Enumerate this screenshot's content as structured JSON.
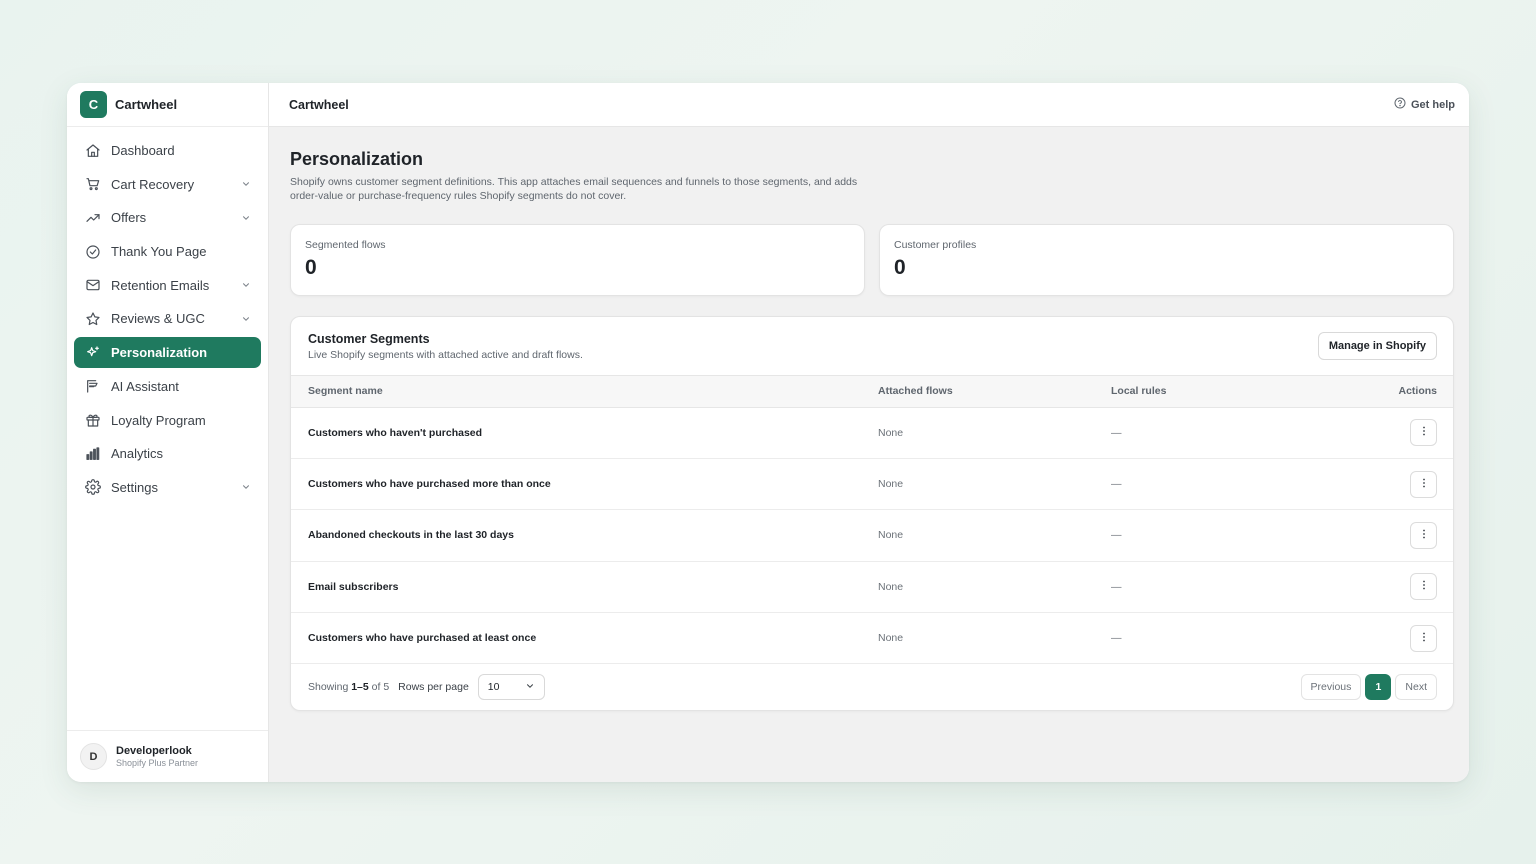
{
  "app": {
    "logo_letter": "C",
    "name": "Cartwheel"
  },
  "sidebar": {
    "items": [
      {
        "label": "Dashboard",
        "icon": "home-icon",
        "expandable": false,
        "active": false
      },
      {
        "label": "Cart Recovery",
        "icon": "cart-icon",
        "expandable": true,
        "active": false
      },
      {
        "label": "Offers",
        "icon": "trending-up-icon",
        "expandable": true,
        "active": false
      },
      {
        "label": "Thank You Page",
        "icon": "check-circle-icon",
        "expandable": false,
        "active": false
      },
      {
        "label": "Retention Emails",
        "icon": "mail-icon",
        "expandable": true,
        "active": false
      },
      {
        "label": "Reviews & UGC",
        "icon": "star-icon",
        "expandable": true,
        "active": false
      },
      {
        "label": "Personalization",
        "icon": "sparkle-icon",
        "expandable": false,
        "active": true
      },
      {
        "label": "AI Assistant",
        "icon": "ai-assistant-icon",
        "expandable": false,
        "active": false
      },
      {
        "label": "Loyalty Program",
        "icon": "gift-icon",
        "expandable": false,
        "active": false
      },
      {
        "label": "Analytics",
        "icon": "bar-chart-icon",
        "expandable": false,
        "active": false
      },
      {
        "label": "Settings",
        "icon": "gear-icon",
        "expandable": true,
        "active": false
      }
    ]
  },
  "user": {
    "initial": "D",
    "name": "Developerlook",
    "role": "Shopify Plus Partner"
  },
  "topbar": {
    "title": "Cartwheel",
    "help_label": "Get help"
  },
  "page": {
    "title": "Personalization",
    "description": "Shopify owns customer segment definitions. This app attaches email sequences and funnels to those segments, and adds order-value or purchase-frequency rules Shopify segments do not cover."
  },
  "stats": [
    {
      "label": "Segmented flows",
      "value": "0"
    },
    {
      "label": "Customer profiles",
      "value": "0"
    }
  ],
  "segments": {
    "title": "Customer Segments",
    "subtitle": "Live Shopify segments with attached active and draft flows.",
    "manage_label": "Manage in Shopify",
    "columns": [
      "Segment name",
      "Attached flows",
      "Local rules",
      "Actions"
    ],
    "rows": [
      {
        "name": "Customers who haven't purchased",
        "flows": "None",
        "rules": "—"
      },
      {
        "name": "Customers who have purchased more than once",
        "flows": "None",
        "rules": "—"
      },
      {
        "name": "Abandoned checkouts in the last 30 days",
        "flows": "None",
        "rules": "—"
      },
      {
        "name": "Email subscribers",
        "flows": "None",
        "rules": "—"
      },
      {
        "name": "Customers who have purchased at least once",
        "flows": "None",
        "rules": "—"
      }
    ],
    "footer": {
      "showing_prefix": "Showing",
      "showing_range": "1–5",
      "showing_of": "of 5",
      "rows_per_page_label": "Rows per page",
      "rows_per_page_value": "10",
      "previous_label": "Previous",
      "current_page": "1",
      "next_label": "Next"
    }
  },
  "colors": {
    "accent": "#1f7a5f",
    "page_bg": "#f1f1f1"
  }
}
